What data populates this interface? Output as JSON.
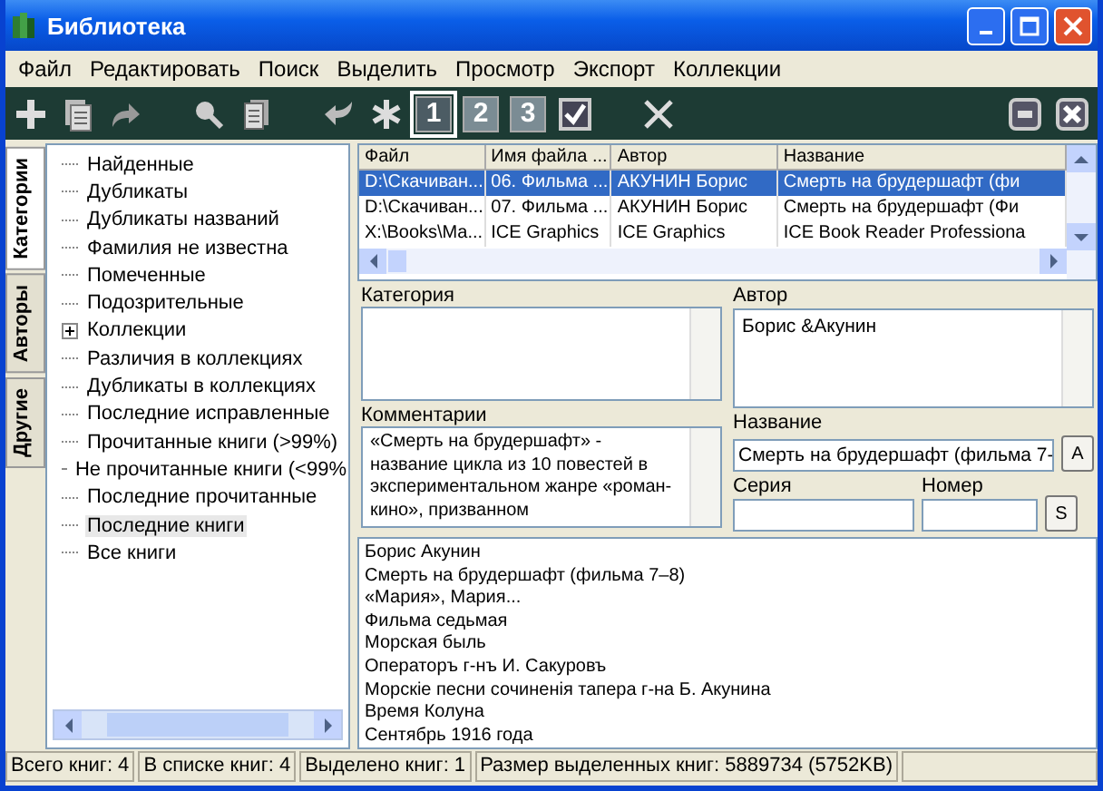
{
  "window": {
    "title": "Библиотека"
  },
  "menu": [
    "Файл",
    "Редактировать",
    "Поиск",
    "Выделить",
    "Просмотр",
    "Экспорт",
    "Коллекции"
  ],
  "toolbar": [
    {
      "kind": "plus"
    },
    {
      "kind": "pages"
    },
    {
      "kind": "forward"
    },
    {
      "kind": "gap"
    },
    {
      "kind": "search"
    },
    {
      "kind": "stack"
    },
    {
      "kind": "gap"
    },
    {
      "kind": "back"
    },
    {
      "kind": "asterisk"
    },
    {
      "kind": "view",
      "label": "1",
      "selected": true
    },
    {
      "kind": "view",
      "label": "2",
      "selected": false
    },
    {
      "kind": "view",
      "label": "3",
      "selected": false
    },
    {
      "kind": "check"
    },
    {
      "kind": "gap"
    },
    {
      "kind": "delete"
    }
  ],
  "side_tabs": [
    {
      "label": "Категории",
      "selected": true
    },
    {
      "label": "Авторы",
      "selected": false
    },
    {
      "label": "Другие",
      "selected": false
    }
  ],
  "tree": [
    {
      "label": "Найденные",
      "selected": false
    },
    {
      "label": "Дубликаты",
      "selected": false
    },
    {
      "label": "Дубликаты названий",
      "selected": false
    },
    {
      "label": "Фамилия не известна",
      "selected": false
    },
    {
      "label": "Помеченные",
      "selected": false
    },
    {
      "label": "Подозрительные",
      "selected": false
    },
    {
      "label": "Коллекции",
      "selected": false,
      "expanded": false
    },
    {
      "label": "Различия в коллекциях",
      "selected": false
    },
    {
      "label": "Дубликаты в коллекциях",
      "selected": false
    },
    {
      "label": "Последние исправленные",
      "selected": false
    },
    {
      "label": "Прочитанные книги (>99%)",
      "selected": false
    },
    {
      "label": "Не прочитанные книги (<99%",
      "selected": false
    },
    {
      "label": "Последние прочитанные",
      "selected": false
    },
    {
      "label": "Последние книги",
      "selected": true
    },
    {
      "label": "Все книги",
      "selected": false
    }
  ],
  "table": {
    "columns": [
      "Файл",
      "Имя файла ...",
      "Автор",
      "Название"
    ],
    "rows": [
      {
        "selected": true,
        "cells": [
          "D:\\Скачиван...",
          "06. Фильма ...",
          "АКУНИН Борис",
          "Смерть на брудершафт (фи"
        ]
      },
      {
        "selected": false,
        "cells": [
          "D:\\Скачиван...",
          "07. Фильма ...",
          "АКУНИН Борис",
          "Смерть на брудершафт (Фи"
        ]
      },
      {
        "selected": false,
        "cells": [
          "X:\\Books\\Ma...",
          "ICE Graphics",
          "ICE Graphics",
          "ICE Book Reader Professiona"
        ]
      }
    ]
  },
  "details": {
    "category": {
      "label": "Категория"
    },
    "author": {
      "label": "Автор",
      "value": "Борис &Акунин"
    },
    "comments": {
      "label": "Комментарии",
      "value": "«Смерть на брудершафт» - название цикла из 10 повестей в экспериментальном жанре «роман-кино», призванном"
    },
    "title": {
      "label": "Название",
      "value": "Смерть на брудершафт (фильма 7-",
      "button": "A"
    },
    "series": {
      "label": "Серия"
    },
    "number": {
      "label": "Номер",
      "button": "S"
    }
  },
  "preview_lines": [
    "Борис Акунин",
    "Смерть на брудершафт (фильма 7–8)",
    "«Мария», Мария...",
    "Фильма седьмая",
    "Морская быль",
    "Операторъ г-нъ И. Сакуровъ",
    "Морскiе песни сочиненiя тапера г-на Б. Акунина",
    "Время Колуна",
    "Сентябрь 1916 года"
  ],
  "status_bar": [
    "Всего книг: 4",
    "В списке книг: 4",
    "Выделено книг: 1",
    "Размер выделенных книг: 5889734  (5752KB)"
  ]
}
